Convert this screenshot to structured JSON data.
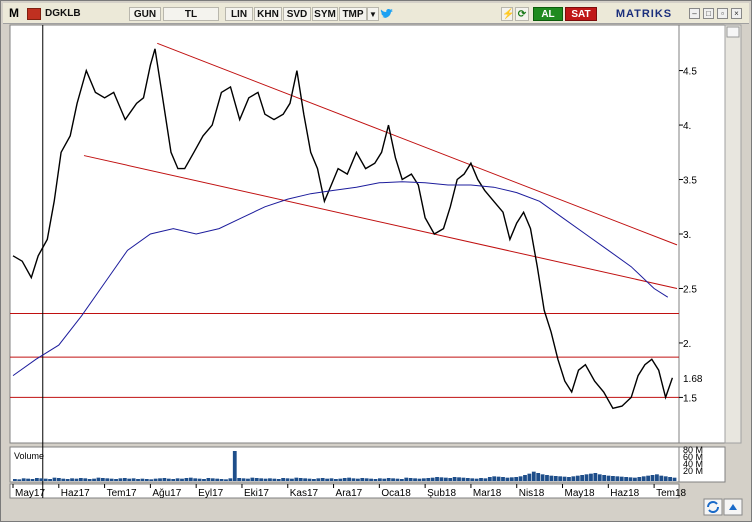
{
  "toolbar": {
    "app_letter": "M",
    "symbol": "DGKLB",
    "buttons": [
      "GUN",
      "TL",
      "LIN",
      "KHN",
      "SVD",
      "SYM",
      "TMP"
    ],
    "buy_label": "AL",
    "sell_label": "SAT",
    "brand": "MATRIKS",
    "colors": {
      "buy": "#1f8a1f",
      "sell": "#c01818",
      "brand": "#1b2f7c"
    },
    "icons": [
      "twitter-icon",
      "lightning-icon",
      "refresh-icon",
      "minimize-icon",
      "maximize-icon",
      "close-icon"
    ]
  },
  "volume_panel": {
    "label": "Volume",
    "tick_labels": [
      "80 M",
      "60 M",
      "40 M",
      "20 M"
    ]
  },
  "chart_data": {
    "type": "line",
    "title": "",
    "xlabel": "",
    "ylabel": "",
    "x_tick_labels": [
      "May17",
      "Haz17",
      "Tem17",
      "Ağu17",
      "Eyl17",
      "Eki17",
      "Kas17",
      "Ara17",
      "Oca18",
      "Şub18",
      "Mar18",
      "Nis18",
      "May18",
      "Haz18",
      "Tem18"
    ],
    "y_tick_labels": [
      "4.5",
      "4.",
      "3.5",
      "3.",
      "2.5",
      "2.",
      "1.5"
    ],
    "y_ticks": [
      4.5,
      4.0,
      3.5,
      3.0,
      2.5,
      2.0,
      1.5
    ],
    "last_value_label": "1.68",
    "last_value": 1.68,
    "ylim": [
      1.1,
      4.9
    ],
    "x_index_range": [
      0,
      14.5
    ],
    "series": [
      {
        "color": "#000000",
        "points": [
          [
            0,
            2.8
          ],
          [
            0.2,
            2.75
          ],
          [
            0.4,
            2.6
          ],
          [
            0.55,
            2.8
          ],
          [
            0.75,
            2.95
          ],
          [
            0.9,
            3.3
          ],
          [
            1.05,
            3.75
          ],
          [
            1.25,
            3.9
          ],
          [
            1.4,
            4.2
          ],
          [
            1.6,
            4.5
          ],
          [
            1.8,
            4.3
          ],
          [
            2.0,
            4.25
          ],
          [
            2.2,
            4.3
          ],
          [
            2.45,
            4.05
          ],
          [
            2.7,
            4.2
          ],
          [
            2.85,
            4.25
          ],
          [
            3.0,
            4.55
          ],
          [
            3.1,
            4.7
          ],
          [
            3.25,
            4.3
          ],
          [
            3.45,
            3.75
          ],
          [
            3.6,
            3.6
          ],
          [
            3.75,
            3.6
          ],
          [
            3.95,
            3.75
          ],
          [
            4.15,
            3.9
          ],
          [
            4.35,
            4.0
          ],
          [
            4.55,
            4.3
          ],
          [
            4.75,
            4.35
          ],
          [
            4.95,
            4.05
          ],
          [
            5.15,
            4.25
          ],
          [
            5.35,
            4.3
          ],
          [
            5.5,
            4.1
          ],
          [
            5.7,
            4.05
          ],
          [
            5.9,
            4.1
          ],
          [
            6.05,
            4.2
          ],
          [
            6.2,
            4.5
          ],
          [
            6.35,
            4.1
          ],
          [
            6.5,
            3.75
          ],
          [
            6.65,
            3.6
          ],
          [
            6.8,
            3.3
          ],
          [
            6.95,
            3.45
          ],
          [
            7.1,
            3.6
          ],
          [
            7.3,
            3.55
          ],
          [
            7.5,
            3.75
          ],
          [
            7.7,
            3.6
          ],
          [
            7.9,
            3.65
          ],
          [
            8.05,
            3.75
          ],
          [
            8.2,
            4.0
          ],
          [
            8.35,
            3.7
          ],
          [
            8.5,
            3.5
          ],
          [
            8.7,
            3.55
          ],
          [
            8.85,
            3.45
          ],
          [
            9.0,
            3.15
          ],
          [
            9.2,
            3.0
          ],
          [
            9.4,
            3.05
          ],
          [
            9.55,
            3.25
          ],
          [
            9.7,
            3.5
          ],
          [
            9.85,
            3.55
          ],
          [
            10.0,
            3.65
          ],
          [
            10.15,
            3.5
          ],
          [
            10.3,
            3.4
          ],
          [
            10.5,
            3.3
          ],
          [
            10.7,
            3.2
          ],
          [
            10.85,
            2.95
          ],
          [
            11.0,
            3.1
          ],
          [
            11.15,
            3.2
          ],
          [
            11.3,
            3.05
          ],
          [
            11.45,
            2.7
          ],
          [
            11.6,
            2.3
          ],
          [
            11.75,
            2.1
          ],
          [
            11.9,
            1.85
          ],
          [
            12.05,
            1.65
          ],
          [
            12.2,
            1.55
          ],
          [
            12.35,
            1.75
          ],
          [
            12.5,
            1.8
          ],
          [
            12.7,
            1.65
          ],
          [
            12.9,
            1.55
          ],
          [
            13.1,
            1.4
          ],
          [
            13.3,
            1.42
          ],
          [
            13.5,
            1.5
          ],
          [
            13.65,
            1.7
          ],
          [
            13.8,
            1.8
          ],
          [
            13.95,
            1.85
          ],
          [
            14.1,
            1.75
          ],
          [
            14.25,
            1.5
          ],
          [
            14.4,
            1.68
          ]
        ]
      },
      {
        "color": "#1c1c9c",
        "points": [
          [
            0,
            1.7
          ],
          [
            0.5,
            1.85
          ],
          [
            1.0,
            1.98
          ],
          [
            1.5,
            2.25
          ],
          [
            2.0,
            2.55
          ],
          [
            2.5,
            2.85
          ],
          [
            3.0,
            3.0
          ],
          [
            3.5,
            3.05
          ],
          [
            4.0,
            3.0
          ],
          [
            4.5,
            3.05
          ],
          [
            5.0,
            3.15
          ],
          [
            5.5,
            3.25
          ],
          [
            6.0,
            3.32
          ],
          [
            6.5,
            3.37
          ],
          [
            7.0,
            3.4
          ],
          [
            7.5,
            3.43
          ],
          [
            8.0,
            3.47
          ],
          [
            8.5,
            3.48
          ],
          [
            9.0,
            3.47
          ],
          [
            9.5,
            3.45
          ],
          [
            10.0,
            3.45
          ],
          [
            10.5,
            3.43
          ],
          [
            11.0,
            3.38
          ],
          [
            11.5,
            3.3
          ],
          [
            12.0,
            3.15
          ],
          [
            12.5,
            3.0
          ],
          [
            13.0,
            2.85
          ],
          [
            13.5,
            2.7
          ],
          [
            14.0,
            2.5
          ],
          [
            14.3,
            2.42
          ]
        ]
      }
    ],
    "trend_lines": [
      {
        "color": "#c01010",
        "from": [
          3.15,
          4.75
        ],
        "to": [
          14.5,
          2.9
        ]
      },
      {
        "color": "#c01010",
        "from": [
          1.55,
          3.72
        ],
        "to": [
          14.5,
          2.5
        ]
      }
    ],
    "horizontal_levels": [
      {
        "color": "#c01010",
        "value": 2.27
      },
      {
        "color": "#c01010",
        "value": 1.87
      },
      {
        "color": "#c01010",
        "value": 1.5
      }
    ],
    "cursor_line_x": 0.65,
    "volume": [
      6,
      5,
      8,
      7,
      6,
      9,
      8,
      7,
      6,
      10,
      9,
      7,
      6,
      8,
      7,
      9,
      8,
      6,
      7,
      10,
      9,
      8,
      7,
      6,
      8,
      9,
      7,
      8,
      6,
      7,
      6,
      5,
      7,
      8,
      9,
      7,
      6,
      8,
      7,
      9,
      10,
      8,
      7,
      6,
      9,
      8,
      7,
      6,
      5,
      8,
      90,
      9,
      8,
      7,
      10,
      9,
      8,
      7,
      8,
      7,
      6,
      9,
      8,
      7,
      10,
      9,
      8,
      7,
      6,
      8,
      9,
      7,
      8,
      6,
      7,
      9,
      10,
      8,
      7,
      9,
      8,
      7,
      6,
      8,
      7,
      9,
      8,
      7,
      6,
      10,
      9,
      8,
      7,
      8,
      9,
      10,
      12,
      11,
      10,
      9,
      12,
      11,
      10,
      9,
      8,
      7,
      9,
      8,
      12,
      14,
      13,
      12,
      10,
      11,
      12,
      14,
      18,
      22,
      28,
      24,
      20,
      18,
      16,
      15,
      14,
      13,
      12,
      14,
      16,
      18,
      20,
      22,
      24,
      20,
      18,
      16,
      15,
      14,
      13,
      12,
      11,
      10,
      12,
      14,
      16,
      18,
      20,
      16,
      14,
      12,
      10
    ]
  }
}
